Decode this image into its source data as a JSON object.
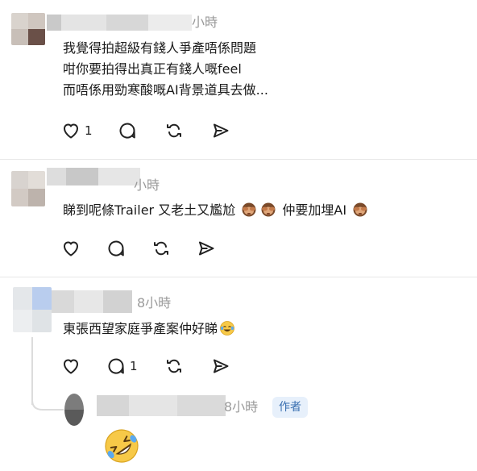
{
  "comments": [
    {
      "time": "小時",
      "lines": [
        "我覺得拍超級有錢人爭產唔係問題",
        "咁你要拍得出真正有錢人嘅feel",
        "而唔係用勁寒酸嘅AI背景道具去做..."
      ],
      "like_count": "1",
      "reply_count": ""
    },
    {
      "time": "小時",
      "text_parts": [
        "睇到呢條Trailer 又老土又尷尬",
        "仲要加埋AI"
      ],
      "emojis": [
        "see-no-evil-monkey",
        "see-no-evil-monkey",
        "see-no-evil-monkey"
      ],
      "like_count": "",
      "reply_count": ""
    },
    {
      "time": "8小時",
      "text": "東張西望家庭爭產案仲好睇",
      "emoji": "tears-of-joy",
      "like_count": "",
      "reply_count": "1"
    }
  ],
  "reply": {
    "time": "8小時",
    "badge": "作者",
    "emoji": "rolling-on-floor-laughing"
  },
  "colors": {
    "divider": "#e6e6e6",
    "meta_text": "#9a9a9a",
    "badge_bg": "#e7f0fb",
    "badge_text": "#3a6fb0",
    "icon_stroke": "#222222"
  }
}
